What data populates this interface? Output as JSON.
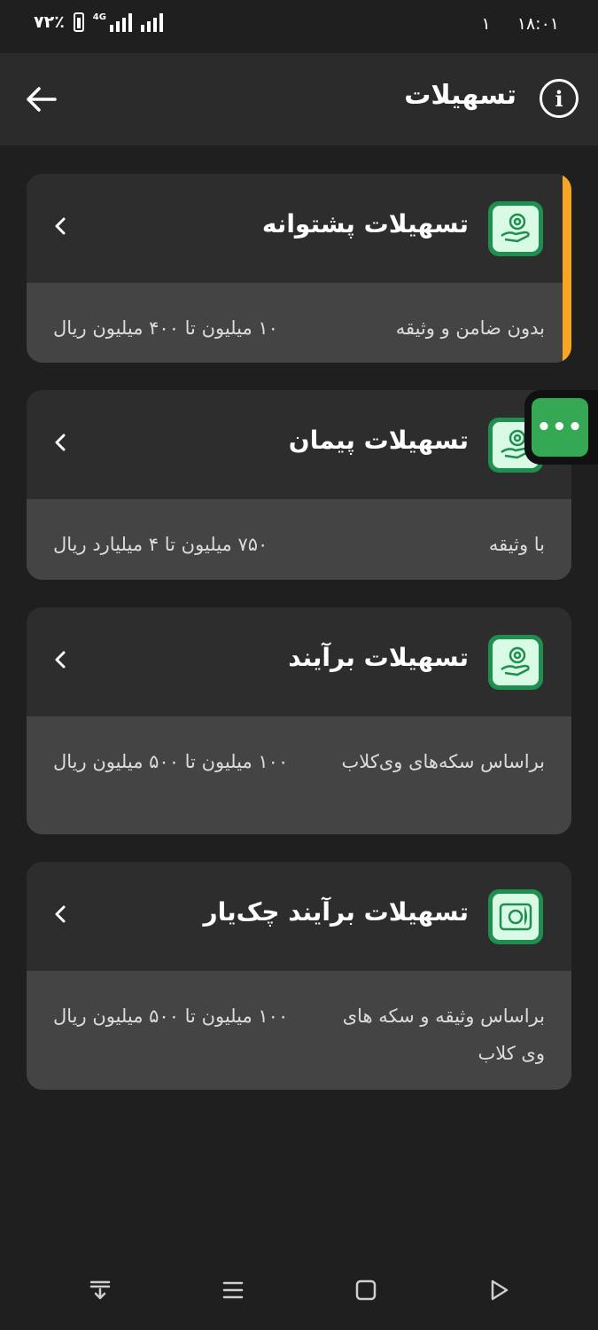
{
  "status_bar": {
    "battery_percent": "۷۲٪",
    "network": "4G",
    "sim": "۱",
    "time": "۱۸:۰۱"
  },
  "app_bar": {
    "title": "تسهیلات",
    "back_icon": "arrow-left-icon",
    "info_icon": "info-icon"
  },
  "cards": [
    {
      "title": "تسهیلات پشتوانه",
      "description": "بدون ضامن و وثیقه",
      "amount": "۱۰ میلیون تا ۴۰۰ میلیون ریال",
      "icon": "hand-coin-icon",
      "highlighted": true
    },
    {
      "title": "تسهیلات پیمان",
      "description": "با وثیقه",
      "amount": "۷۵۰ میلیون تا ۴ میلیارد ریال",
      "icon": "hand-coin-icon"
    },
    {
      "title": "تسهیلات برآیند",
      "description": "براساس سکه‌های وی‌کلاب",
      "amount": "۱۰۰ میلیون تا ۵۰۰ میلیون ریال",
      "icon": "hand-coin-icon"
    },
    {
      "title": "تسهیلات برآیند چک‌یار",
      "description": "براساس وثیقه و سکه های وی کلاب",
      "amount": "۱۰۰ میلیون تا ۵۰۰ میلیون ریال",
      "icon": "cheque-icon"
    }
  ],
  "fab": {
    "label": "•••",
    "icon": "chat-more-icon"
  },
  "nav": [
    "notification-shade-icon",
    "menu-icon",
    "home-icon",
    "back-triangle-icon"
  ],
  "colors": {
    "accent": "#f5a623",
    "green": "#35a853",
    "icon_bg": "#d9fbe6"
  }
}
